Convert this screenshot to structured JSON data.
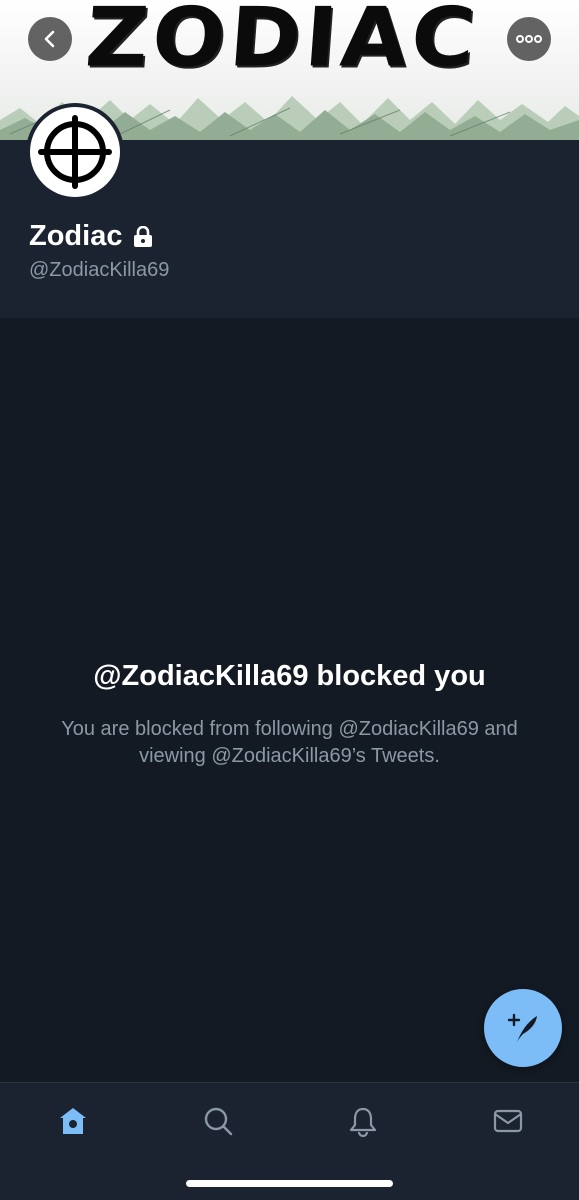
{
  "banner": {
    "title": "ZODIAC"
  },
  "profile": {
    "display_name": "Zodiac",
    "handle": "@ZodiacKilla69",
    "protected_icon": "lock-icon"
  },
  "blocked": {
    "title": "@ZodiacKilla69 blocked you",
    "description": "You are blocked from following @ZodiacKilla69 and viewing @ZodiacKilla69’s Tweets."
  },
  "nav": {
    "back_icon": "chevron-left-icon",
    "more_icon": "more-icon",
    "compose_icon": "compose-tweet-icon",
    "tabs": [
      {
        "name": "home",
        "icon": "home-icon",
        "active": true
      },
      {
        "name": "search",
        "icon": "search-icon",
        "active": false
      },
      {
        "name": "notifications",
        "icon": "bell-icon",
        "active": false
      },
      {
        "name": "messages",
        "icon": "mail-icon",
        "active": false
      }
    ]
  },
  "colors": {
    "background": "#141a23",
    "panel": "#1b2330",
    "accent": "#7cbdf8",
    "secondary_text": "#8b98a5"
  }
}
